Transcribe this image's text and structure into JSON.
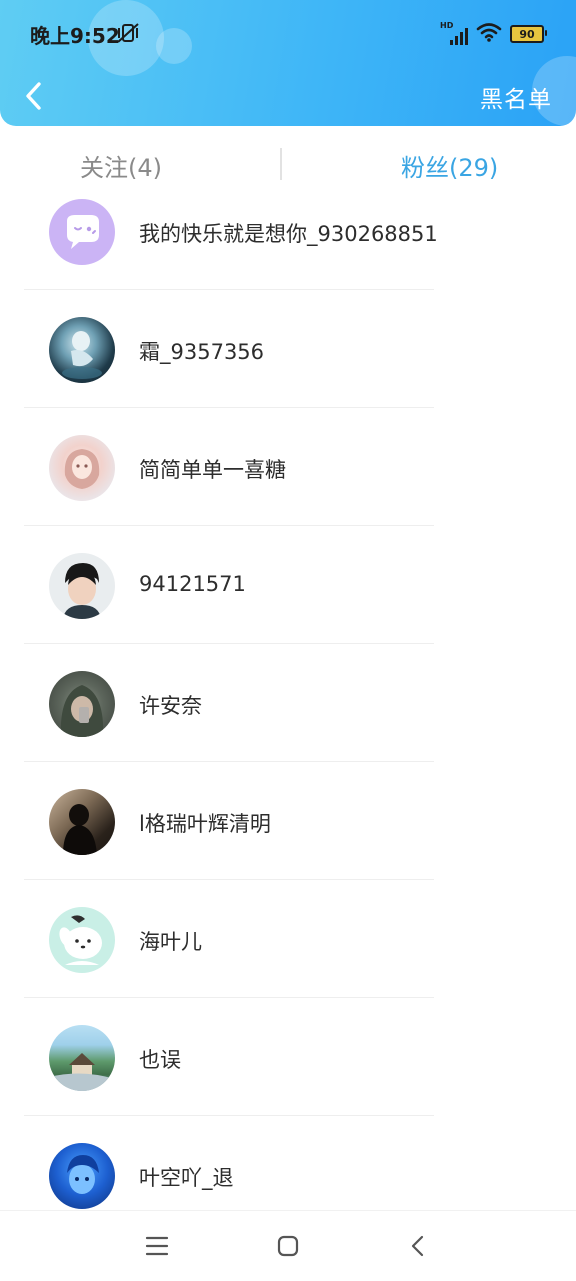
{
  "status_bar": {
    "time": "晚上9:52",
    "hd_label": "HD",
    "battery_level": "90",
    "icons": [
      "vibrate-off-icon",
      "cellular-signal-icon",
      "wifi-icon",
      "battery-icon"
    ]
  },
  "header": {
    "back_icon": "chevron-left-icon",
    "right_action": "黑名单",
    "colors": {
      "gradient_start": "#5fcdf3",
      "gradient_end": "#2aa2f6"
    }
  },
  "tabs": {
    "follow_label": "关注(4)",
    "fans_label": "粉丝(29)",
    "active": "fans",
    "active_color": "#3aa5e3",
    "inactive_color": "#8a8a8a"
  },
  "fans": [
    {
      "name": "我的快乐就是想你_930268851",
      "avatar": "default-chat-avatar"
    },
    {
      "name": "霜_9357356",
      "avatar": "anime-girl-avatar"
    },
    {
      "name": "简简单单一喜糖",
      "avatar": "anime-girl-pink-hair-avatar"
    },
    {
      "name": "94121571",
      "avatar": "boy-photo-avatar"
    },
    {
      "name": "许安奈",
      "avatar": "hooded-figure-avatar"
    },
    {
      "name": "l格瑞叶辉清明",
      "avatar": "dark-silhouette-avatar"
    },
    {
      "name": "海叶儿",
      "avatar": "pochacco-cartoon-avatar"
    },
    {
      "name": "也误",
      "avatar": "landscape-avatar"
    },
    {
      "name": "叶空吖_退",
      "avatar": "blue-character-avatar"
    }
  ],
  "nav_bar": {
    "icons": [
      "menu-icon",
      "home-square-icon",
      "back-triangle-icon"
    ]
  }
}
